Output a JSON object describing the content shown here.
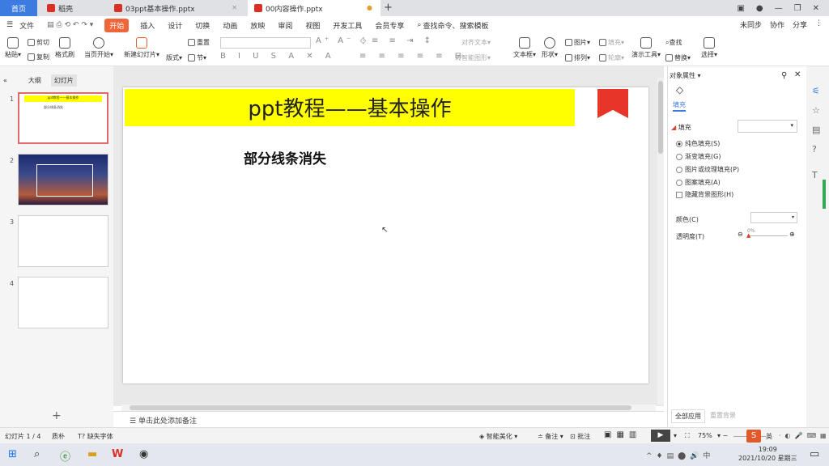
{
  "tabs": {
    "home": "首页",
    "t1": "稻壳",
    "t2": "03ppt基本操作.pptx",
    "t3": "00内容操作.pptx"
  },
  "menu": {
    "file": "文件",
    "start": "开始",
    "items": [
      "插入",
      "设计",
      "切换",
      "动画",
      "放映",
      "审阅",
      "视图",
      "开发工具",
      "会员专享"
    ],
    "search": "查找命令、搜索模板",
    "unsync": "未同步",
    "collab": "协作",
    "share": "分享"
  },
  "ribbon": {
    "paste": "粘贴",
    "cut": "剪切",
    "copy": "复制",
    "format_painter": "格式刷",
    "from_current": "当页开始",
    "new_slide": "新建幻灯片",
    "layout": "版式",
    "section": "节",
    "reset": "重置",
    "align_text": "对齐文本",
    "to_smartart": "转智能图形",
    "textbox": "文本框",
    "shape": "形状",
    "picture": "图片",
    "fill": "填充",
    "arrange": "排列",
    "outline": "轮廓",
    "present_tools": "演示工具",
    "find": "查找",
    "replace": "替换",
    "select": "选择"
  },
  "left_panel": {
    "outline_tab": "大纲",
    "slides_tab": "幻灯片",
    "slide_numbers": [
      "1",
      "2",
      "3",
      "4"
    ],
    "add": "+"
  },
  "slide": {
    "title": "ppt教程——基本操作",
    "subtitle": "部分线条消失",
    "thumb_title": "ppt教程——基本操作",
    "thumb_sub": "部分线条消失"
  },
  "notes": "单击此处添加备注",
  "right_panel": {
    "header": "对象属性",
    "tab_fill": "填充",
    "fill_section": "填充",
    "options": [
      "纯色填充(S)",
      "渐变填充(G)",
      "图片或纹理填充(P)",
      "图案填充(A)"
    ],
    "hide_bg": "隐藏背景图形(H)",
    "color": "颜色(C)",
    "transparency": "透明度(T)",
    "transparency_value": "0%",
    "apply_all": "全部应用",
    "reset_bg": "重置背景"
  },
  "status": {
    "slide_info": "幻灯片 1 / 4",
    "theme": "质朴",
    "missing_font": "缺失字体",
    "smart_beautify": "智能美化",
    "notes": "备注",
    "comment": "批注",
    "zoom": "75%"
  },
  "taskbar": {
    "time": "19:09",
    "date": "2021/10/20 星期三",
    "ime": "英"
  }
}
